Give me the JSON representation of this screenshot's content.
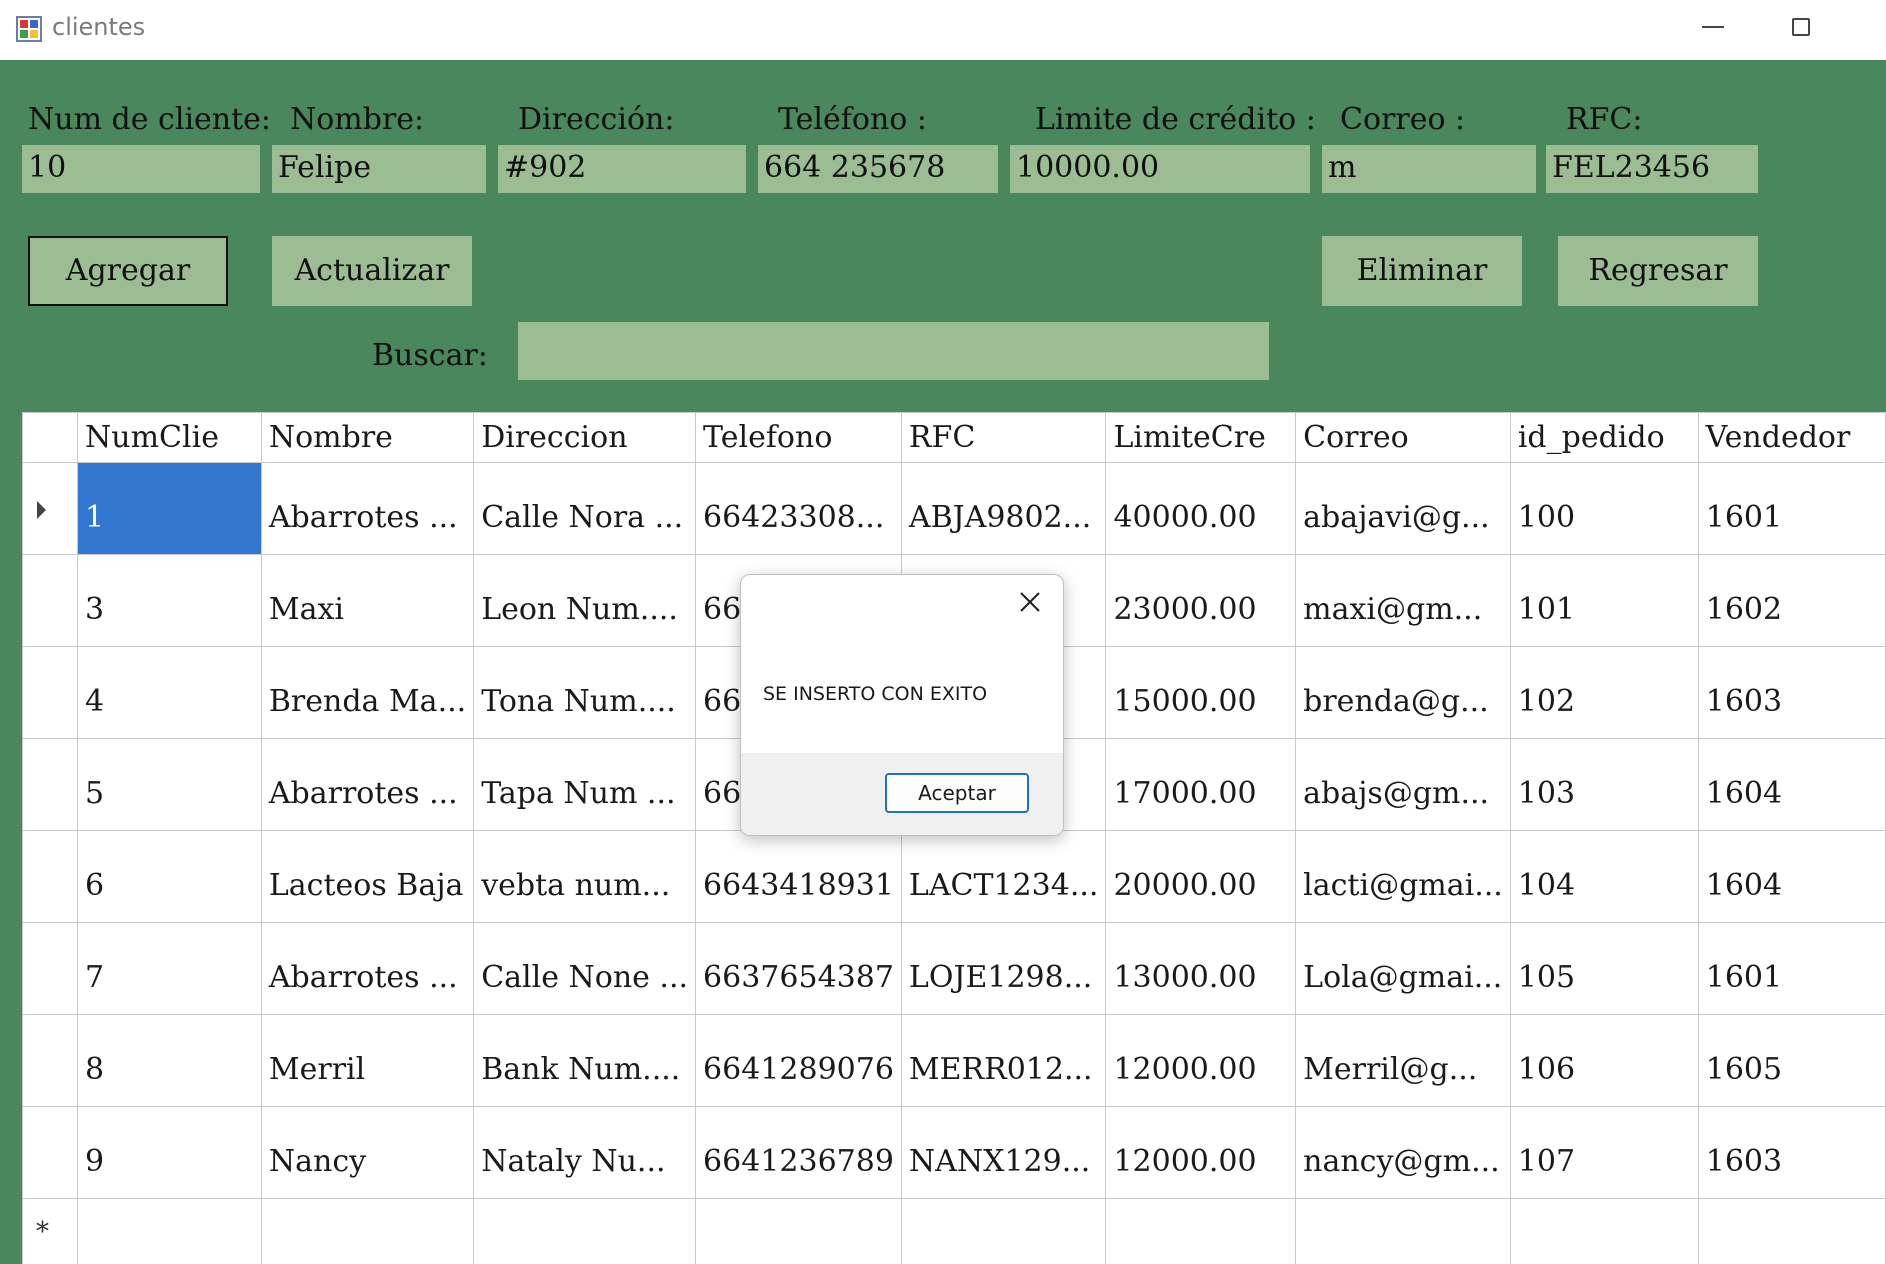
{
  "window": {
    "title": "clientes"
  },
  "form": {
    "labels": {
      "num_cliente": "Num de cliente:",
      "nombre": "Nombre:",
      "direccion": "Dirección:",
      "telefono": "Teléfono :",
      "limite": "Limite de crédito :",
      "correo": "Correo :",
      "rfc": "RFC:"
    },
    "values": {
      "num_cliente": "10",
      "nombre": "Felipe",
      "direccion": "#902",
      "telefono": "664 235678",
      "limite": "10000.00",
      "correo": "m",
      "rfc": "FEL23456"
    },
    "buttons": {
      "agregar": "Agregar",
      "actualizar": "Actualizar",
      "eliminar": "Eliminar",
      "regresar": "Regresar"
    },
    "search_label": "Buscar:",
    "search_value": ""
  },
  "grid": {
    "columns": [
      "NumClie",
      "Nombre",
      "Direccion",
      "Telefono",
      "RFC",
      "LimiteCre",
      "Correo",
      "id_pedido",
      "Vendedor"
    ],
    "rows": [
      [
        "1",
        "Abarrotes ...",
        "Calle Nora ...",
        "66423308...",
        "ABJA9802...",
        "40000.00",
        "abajavi@g...",
        "100",
        "1601"
      ],
      [
        "3",
        "Maxi",
        "Leon Num....",
        "66",
        "...",
        "23000.00",
        "maxi@gm...",
        "101",
        "1602"
      ],
      [
        "4",
        "Brenda Ma...",
        "Tona Num....",
        "66",
        "...",
        "15000.00",
        "brenda@g...",
        "102",
        "1603"
      ],
      [
        "5",
        "Abarrotes ...",
        "Tapa Num ...",
        "66",
        "...",
        "17000.00",
        "abajs@gm...",
        "103",
        "1604"
      ],
      [
        "6",
        "Lacteos Baja",
        "vebta num...",
        "6643418931",
        "LACT1234...",
        "20000.00",
        "lacti@gmai...",
        "104",
        "1604"
      ],
      [
        "7",
        "Abarrotes ...",
        "Calle None ...",
        "6637654387",
        "LOJE1298...",
        "13000.00",
        "Lola@gmai...",
        "105",
        "1601"
      ],
      [
        "8",
        "Merril",
        "Bank Num....",
        "6641289076",
        "MERR012...",
        "12000.00",
        "Merril@g...",
        "106",
        "1605"
      ],
      [
        "9",
        "Nancy",
        "Nataly Nu...",
        "6641236789",
        "NANX129...",
        "12000.00",
        "nancy@gm...",
        "107",
        "1603"
      ]
    ]
  },
  "dialog": {
    "message": "SE INSERTO CON EXITO",
    "ok_label": "Aceptar"
  }
}
